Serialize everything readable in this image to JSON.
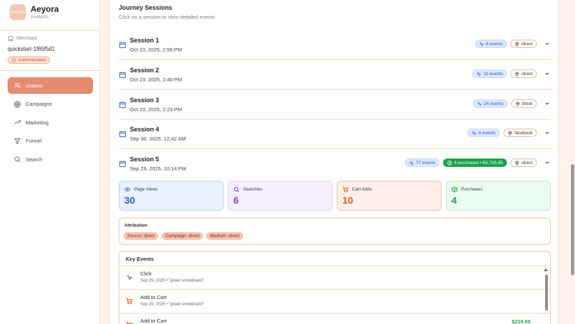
{
  "brand": {
    "name": "Aeyora",
    "subtitle": "Analytics",
    "logo_text": "Aeyora"
  },
  "merchant": {
    "label": "Merchant",
    "id": "quickstart-1f65f5d1",
    "status": "Authenticated"
  },
  "nav": [
    {
      "label": "Visitors",
      "icon": "users-icon",
      "active": true
    },
    {
      "label": "Campaigns",
      "icon": "target-icon",
      "active": false
    },
    {
      "label": "Marketing",
      "icon": "trending-up-icon",
      "active": false
    },
    {
      "label": "Funnel",
      "icon": "funnel-icon",
      "active": false
    },
    {
      "label": "Search",
      "icon": "search-icon",
      "active": false
    }
  ],
  "journey": {
    "title": "Journey Sessions",
    "subtitle": "Click on a session to view detailed events",
    "sessions": [
      {
        "name": "Session 1",
        "date": "Oct 23, 2025, 2:56 PM",
        "events": "8 events",
        "source": "direct",
        "expanded": false
      },
      {
        "name": "Session 2",
        "date": "Oct 23, 2025, 2:40 PM",
        "events": "11 events",
        "source": "direct",
        "expanded": false
      },
      {
        "name": "Session 3",
        "date": "Oct 23, 2025, 2:23 PM",
        "events": "24 events",
        "source": "tiktok",
        "expanded": false
      },
      {
        "name": "Session 4",
        "date": "Sep 30, 2025, 12:42 AM",
        "events": "4 events",
        "source": "facebook",
        "expanded": false
      },
      {
        "name": "Session 5",
        "date": "Sep 29, 2025, 10:14 PM",
        "events": "77 events",
        "purchases": "4 purchases • $3,705.95",
        "source": "direct",
        "expanded": true
      }
    ]
  },
  "stats": [
    {
      "label": "Page Views",
      "value": "30",
      "color": "#2e5ab8"
    },
    {
      "label": "Searches",
      "value": "6",
      "color": "#8b3fc7"
    },
    {
      "label": "Cart Adds",
      "value": "10",
      "color": "#e0541e"
    },
    {
      "label": "Purchases",
      "value": "4",
      "color": "#17a34a"
    }
  ],
  "attribution": {
    "title": "Attribution",
    "chips": [
      "Source: direct",
      "Campaign: direct",
      "Medium: direct"
    ]
  },
  "key_events": {
    "title": "Key Events",
    "rows": [
      {
        "name": "Click",
        "desc": "Sep 29, 2025 • \"green snowboard\"",
        "amount": ""
      },
      {
        "name": "Add to Cart",
        "desc": "Sep 29, 2025 • \"green snowboard\"",
        "amount": ""
      },
      {
        "name": "Add to Cart",
        "desc": "",
        "amount": "$219.00"
      }
    ]
  },
  "colors": {
    "accent": "#e58c6e",
    "events_blue": "#2e5ab8",
    "purchase_green": "#17a34a"
  }
}
